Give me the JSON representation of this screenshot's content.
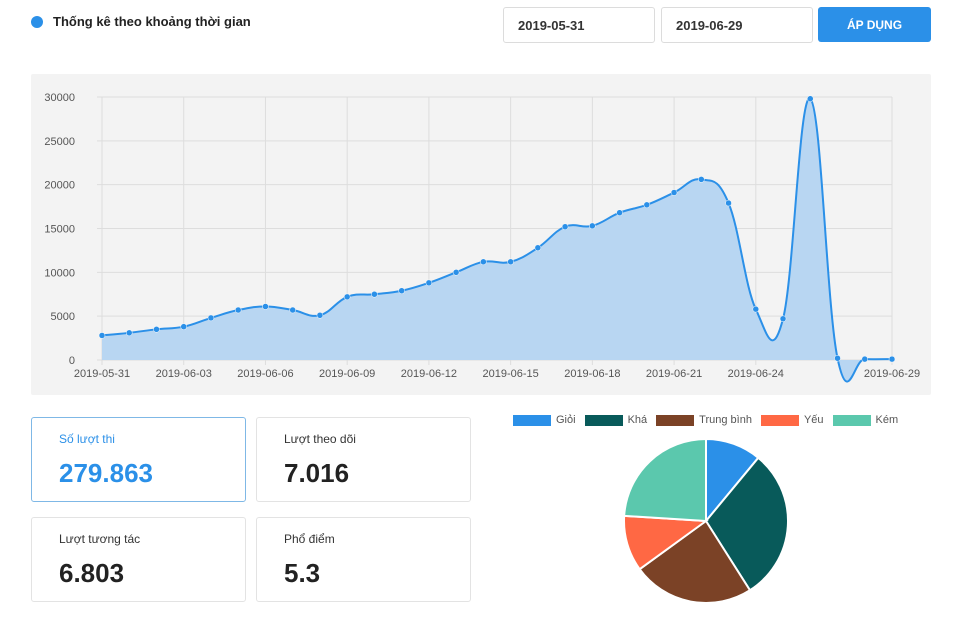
{
  "header": {
    "title": "Thống kê theo khoảng thời gian"
  },
  "filters": {
    "date_from": "2019-05-31",
    "date_to": "2019-06-29",
    "apply_label": "ÁP DỤNG"
  },
  "stats": [
    {
      "label": "Số lượt thi",
      "value": "279.863"
    },
    {
      "label": "Lượt theo dõi",
      "value": "7.016"
    },
    {
      "label": "Lượt tương tác",
      "value": "6.803"
    },
    {
      "label": "Phổ điểm",
      "value": "5.3"
    }
  ],
  "colors": {
    "accent": "#2b90e8",
    "area_fill": "#b8d6f2",
    "panel_bg": "#f3f3f3"
  },
  "chart_data": [
    {
      "type": "area",
      "x": [
        "2019-05-31",
        "2019-06-01",
        "2019-06-02",
        "2019-06-03",
        "2019-06-04",
        "2019-06-05",
        "2019-06-06",
        "2019-06-07",
        "2019-06-08",
        "2019-06-09",
        "2019-06-10",
        "2019-06-11",
        "2019-06-12",
        "2019-06-13",
        "2019-06-14",
        "2019-06-15",
        "2019-06-16",
        "2019-06-17",
        "2019-06-18",
        "2019-06-19",
        "2019-06-20",
        "2019-06-21",
        "2019-06-22",
        "2019-06-23",
        "2019-06-24",
        "2019-06-25",
        "2019-06-26",
        "2019-06-27",
        "2019-06-28",
        "2019-06-29"
      ],
      "values": [
        2800,
        3100,
        3500,
        3800,
        4800,
        5700,
        6100,
        5700,
        5100,
        7200,
        7500,
        7900,
        8800,
        10000,
        11200,
        11200,
        12800,
        15200,
        15300,
        16800,
        17700,
        19100,
        20600,
        17900,
        5800,
        4700,
        29800,
        200,
        100,
        100
      ],
      "xtick_labels": [
        "2019-05-31",
        "2019-06-03",
        "2019-06-06",
        "2019-06-09",
        "2019-06-12",
        "2019-06-15",
        "2019-06-18",
        "2019-06-21",
        "2019-06-24",
        "2019-06-29"
      ],
      "yticks": [
        0,
        5000,
        10000,
        15000,
        20000,
        25000,
        30000
      ],
      "ylim": [
        0,
        30000
      ],
      "grid": true
    },
    {
      "type": "pie",
      "series": [
        {
          "name": "Giỏi",
          "value": 11,
          "color": "#2b90e8"
        },
        {
          "name": "Khá",
          "value": 30,
          "color": "#085a5a"
        },
        {
          "name": "Trung bình",
          "value": 24,
          "color": "#7b4226"
        },
        {
          "name": "Yếu",
          "value": 11,
          "color": "#ff6844"
        },
        {
          "name": "Kém",
          "value": 24,
          "color": "#5bc8ad"
        }
      ],
      "legend": "top"
    }
  ]
}
